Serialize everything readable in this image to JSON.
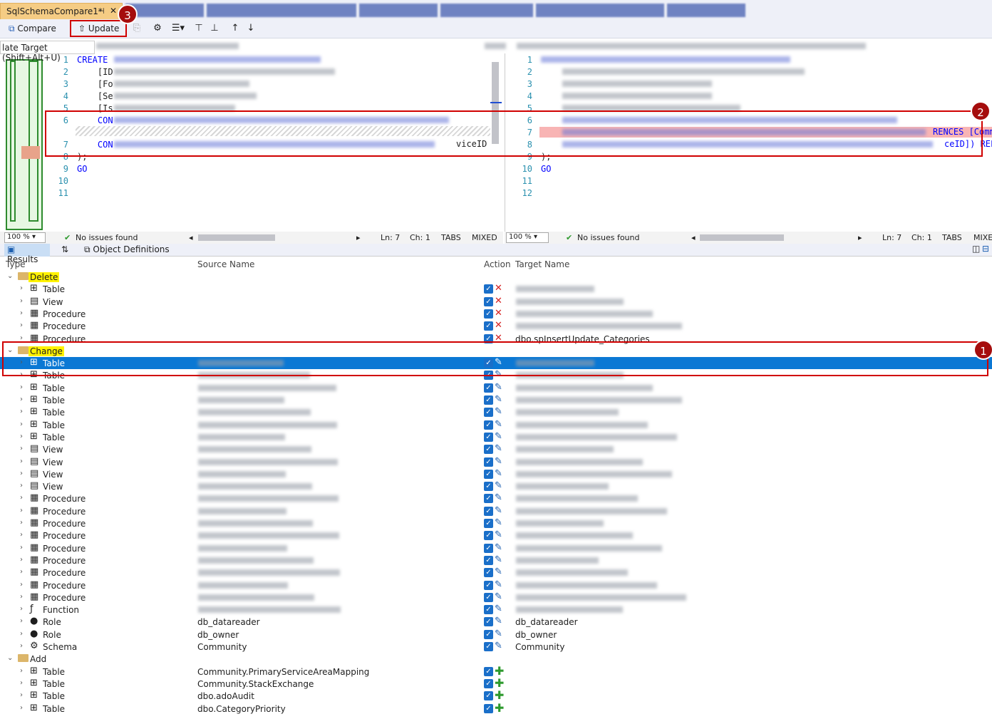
{
  "window": {
    "tab_title": "SqlSchemaCompare1*",
    "pin_icon": "pin-icon",
    "close_icon": "close-icon"
  },
  "toolbar": {
    "compare_label": "Compare",
    "update_label": "Update",
    "tooltip": "late Target (Shift+Alt+U)"
  },
  "left_editor": {
    "lines": [
      {
        "n": "1",
        "text": "CREATE"
      },
      {
        "n": "2",
        "text": "    [ID"
      },
      {
        "n": "3",
        "text": "    [Fo"
      },
      {
        "n": "4",
        "text": "    [Se"
      },
      {
        "n": "5",
        "text": "    [Is"
      },
      {
        "n": "6",
        "text": "    CON"
      },
      {
        "n": "7",
        "text": "    CON"
      },
      {
        "n": "8",
        "text": ");"
      },
      {
        "n": "9",
        "text": "GO"
      },
      {
        "n": "10",
        "text": ""
      },
      {
        "n": "11",
        "text": ""
      }
    ],
    "tail_text": "viceID"
  },
  "right_editor": {
    "lines": [
      {
        "n": "1",
        "text": ""
      },
      {
        "n": "2",
        "text": ""
      },
      {
        "n": "3",
        "text": ""
      },
      {
        "n": "4",
        "text": ""
      },
      {
        "n": "5",
        "text": ""
      },
      {
        "n": "6",
        "text": ""
      },
      {
        "n": "7",
        "text": ""
      },
      {
        "n": "8",
        "text": ""
      },
      {
        "n": "9",
        "text": ");"
      },
      {
        "n": "10",
        "text": "GO"
      },
      {
        "n": "11",
        "text": ""
      },
      {
        "n": "12",
        "text": ""
      }
    ],
    "tail7": "RENCES [Comm",
    "tail8": "ceID]) REFER"
  },
  "status_left": {
    "zoom": "100 %",
    "issues": "No issues found",
    "ln": "Ln: 7",
    "ch": "Ch: 1",
    "tabs": "TABS",
    "mixed": "MIXED"
  },
  "status_right": {
    "zoom": "100 %",
    "issues": "No issues found",
    "ln": "Ln: 7",
    "ch": "Ch: 1",
    "tabs": "TABS",
    "mixed": "MIXE"
  },
  "results_tabs": {
    "results": "Results",
    "object_definitions": "Object Definitions"
  },
  "grid": {
    "col_type": "Type",
    "col_source": "Source Name",
    "col_action": "Action",
    "col_target": "Target Name"
  },
  "groups": {
    "delete": "Delete",
    "change": "Change",
    "add": "Add"
  },
  "delete_rows": [
    {
      "type": "Table",
      "target": ""
    },
    {
      "type": "View",
      "target": ""
    },
    {
      "type": "Procedure",
      "target": ""
    },
    {
      "type": "Procedure",
      "target": ""
    },
    {
      "type": "Procedure",
      "target": "dbo.spInsertUpdate_Categories"
    }
  ],
  "change_rows": [
    {
      "type": "Table",
      "source": "",
      "target": ""
    },
    {
      "type": "Table",
      "source": "",
      "target": ""
    },
    {
      "type": "Table",
      "source": "",
      "target": ""
    },
    {
      "type": "Table",
      "source": "",
      "target": ""
    },
    {
      "type": "Table",
      "source": "",
      "target": ""
    },
    {
      "type": "Table",
      "source": "",
      "target": ""
    },
    {
      "type": "Table",
      "source": "",
      "target": ""
    },
    {
      "type": "View",
      "source": "",
      "target": ""
    },
    {
      "type": "View",
      "source": "",
      "target": ""
    },
    {
      "type": "View",
      "source": "",
      "target": ""
    },
    {
      "type": "View",
      "source": "",
      "target": ""
    },
    {
      "type": "Procedure",
      "source": "",
      "target": ""
    },
    {
      "type": "Procedure",
      "source": "",
      "target": ""
    },
    {
      "type": "Procedure",
      "source": "",
      "target": ""
    },
    {
      "type": "Procedure",
      "source": "",
      "target": ""
    },
    {
      "type": "Procedure",
      "source": "",
      "target": ""
    },
    {
      "type": "Procedure",
      "source": "",
      "target": ""
    },
    {
      "type": "Procedure",
      "source": "",
      "target": ""
    },
    {
      "type": "Procedure",
      "source": "",
      "target": ""
    },
    {
      "type": "Procedure",
      "source": "",
      "target": ""
    },
    {
      "type": "Function",
      "source": "",
      "target": ""
    },
    {
      "type": "Role",
      "source": "db_datareader",
      "target": "db_datareader"
    },
    {
      "type": "Role",
      "source": "db_owner",
      "target": "db_owner"
    },
    {
      "type": "Schema",
      "source": "Community",
      "target": "Community"
    }
  ],
  "add_rows": [
    {
      "type": "Table",
      "source": "Community.PrimaryServiceAreaMapping"
    },
    {
      "type": "Table",
      "source": "Community.StackExchange"
    },
    {
      "type": "Table",
      "source": "dbo.adoAudit"
    },
    {
      "type": "Table",
      "source": "dbo.CategoryPriority"
    }
  ],
  "badges": {
    "b1": "1",
    "b2": "2",
    "b3": "3"
  },
  "colors": {
    "selected": "#0b78d4",
    "highlight": "#fff200",
    "annotation": "#d00000",
    "delete_icon": "#d42020",
    "add_icon": "#2e9a2e"
  }
}
